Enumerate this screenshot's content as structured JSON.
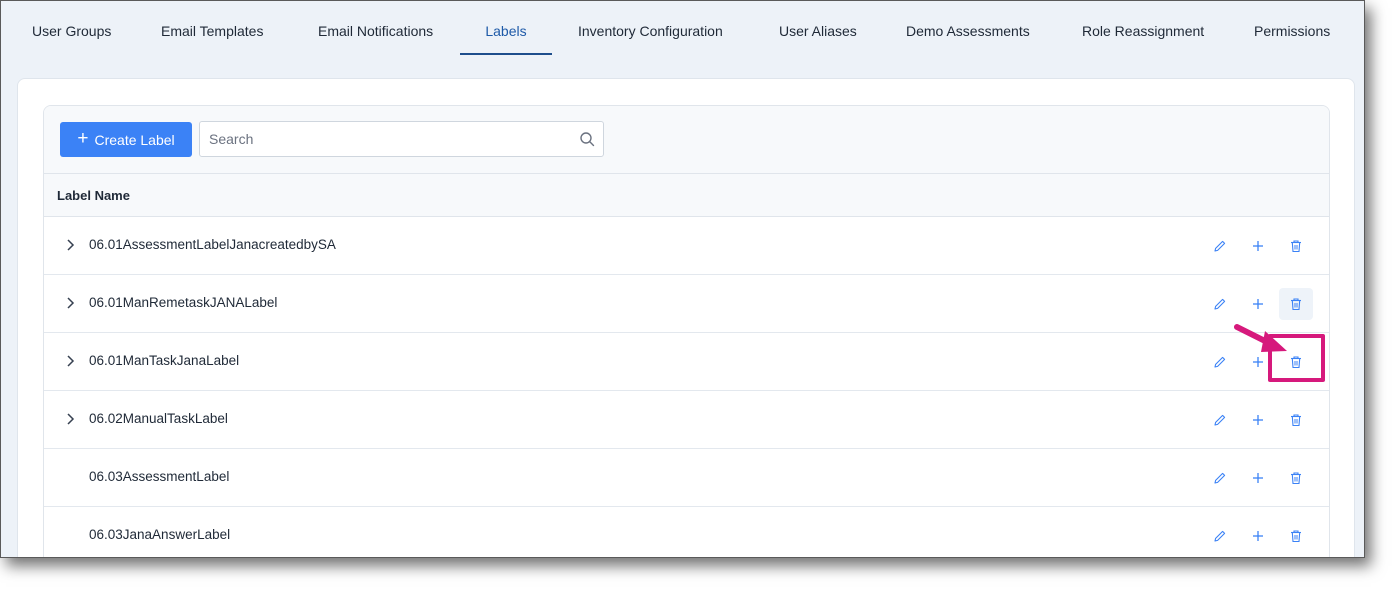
{
  "tabs": [
    {
      "label": "User Groups",
      "active": false
    },
    {
      "label": "Email Templates",
      "active": false
    },
    {
      "label": "Email Notifications",
      "active": false
    },
    {
      "label": "Labels",
      "active": true
    },
    {
      "label": "Inventory Configuration",
      "active": false
    },
    {
      "label": "User Aliases",
      "active": false
    },
    {
      "label": "Demo Assessments",
      "active": false
    },
    {
      "label": "Role Reassignment",
      "active": false
    },
    {
      "label": "Permissions",
      "active": false
    }
  ],
  "toolbar": {
    "create_label": "Create Label",
    "create_icon": "plus-icon",
    "search_placeholder": "Search",
    "search_value": "",
    "search_icon": "search-icon"
  },
  "table": {
    "column_header": "Label Name",
    "rows": [
      {
        "name": "06.01AssessmentLabelJanacreatedbySA",
        "expandable": true
      },
      {
        "name": "06.01ManRemetaskJANALabel",
        "expandable": true
      },
      {
        "name": "06.01ManTaskJanaLabel",
        "expandable": true
      },
      {
        "name": "06.02ManualTaskLabel",
        "expandable": true
      },
      {
        "name": "06.03AssessmentLabel",
        "expandable": false
      },
      {
        "name": "06.03JanaAnswerLabel",
        "expandable": false
      }
    ],
    "row_actions": [
      "edit-icon",
      "plus-icon",
      "trash-icon"
    ]
  },
  "colors": {
    "primary": "#3b82f6",
    "active_tab": "#1e4e8c",
    "action_icon": "#3b82f6",
    "annotation": "#d6197c"
  }
}
